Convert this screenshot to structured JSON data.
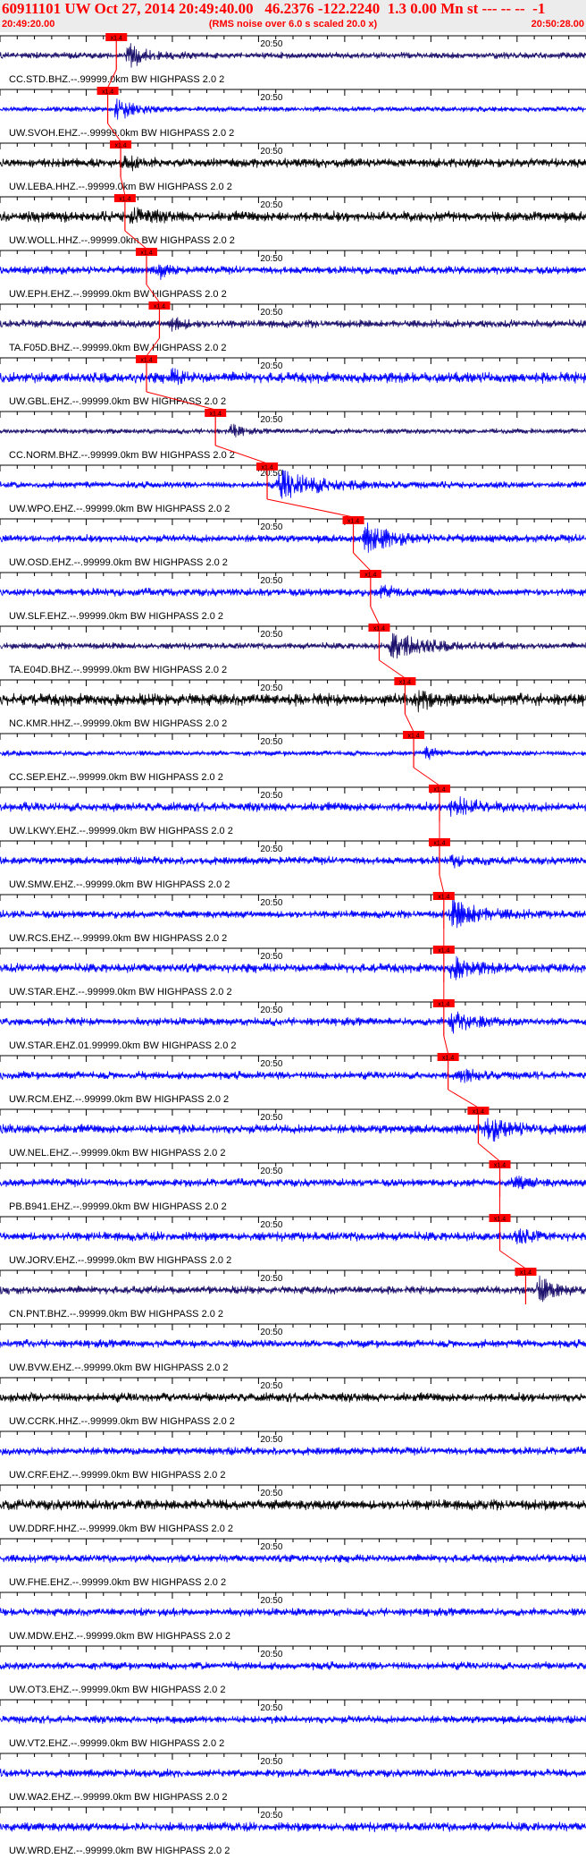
{
  "header": {
    "title": "60911101 UW Oct 27, 2014 20:49:40.00   46.2376 -122.2240  1.3 0.00 Mn st --- -- --  -1",
    "start_time": "20:49:20.00",
    "scale_note": "(RMS noise over 6.0 s scaled 20.0 x)",
    "end_time": "20:50:28.00"
  },
  "time_axis": {
    "minute_label": "20:50",
    "seconds_span": 68
  },
  "colors": {
    "background": "#ffffff",
    "header_bg": "#ececec",
    "header_text": "#ff0000",
    "axis": "#000000",
    "pick": "#ff0000",
    "trace_blue": "#0000ff",
    "trace_navy": "#1a0f6b",
    "trace_black": "#000000"
  },
  "stations": [
    {
      "label": "CC.STD.BHZ.--.99999.0km BW  HIGHPASS  2.0  2",
      "pick": "x1.4",
      "color": "navy",
      "pick_s": 13.5,
      "onset_s": 14.5,
      "duration_s": 4,
      "peak": 1.0,
      "noise": 0.25
    },
    {
      "label": "UW.SVOH.EHZ.--.99999.0km BW  HIGHPASS  2.0  2",
      "pick": "x1.4",
      "color": "blue",
      "pick_s": 12.5,
      "onset_s": 13.0,
      "duration_s": 4,
      "peak": 1.0,
      "noise": 0.2
    },
    {
      "label": "UW.LEBA.HHZ.--.99999.0km BW  HIGHPASS  2.0  2",
      "pick": "x1.4",
      "color": "black",
      "pick_s": 14.0,
      "onset_s": 14.0,
      "duration_s": 3,
      "peak": 0.6,
      "noise": 0.35
    },
    {
      "label": "UW.WOLL.HHZ.--.99999.0km BW  HIGHPASS  2.0  2",
      "pick": "x1.4",
      "color": "black",
      "pick_s": 14.5,
      "onset_s": 15.0,
      "duration_s": 4,
      "peak": 0.6,
      "noise": 0.4
    },
    {
      "label": "UW.EPH.EHZ.--.99999.0km BW  HIGHPASS  2.0  2",
      "pick": "x1.4",
      "color": "blue",
      "pick_s": 17.0,
      "onset_s": 18.0,
      "duration_s": 2,
      "peak": 0.8,
      "noise": 0.3
    },
    {
      "label": "TA.F05D.BHZ.--.99999.0km BW  HIGHPASS  2.0  2",
      "pick": "x1.4",
      "color": "navy",
      "pick_s": 18.5,
      "onset_s": 19.5,
      "duration_s": 3,
      "peak": 0.6,
      "noise": 0.3
    },
    {
      "label": "UW.GBL.EHZ.--.99999.0km BW  HIGHPASS  2.0  2",
      "pick": "x1.4",
      "color": "blue",
      "pick_s": 17.0,
      "onset_s": 19.5,
      "duration_s": 3,
      "peak": 0.5,
      "noise": 0.4
    },
    {
      "label": "CC.NORM.BHZ.--.99999.0km BW  HIGHPASS  2.0  2",
      "pick": "x1.4",
      "color": "navy",
      "pick_s": 25.0,
      "onset_s": 26.5,
      "duration_s": 2,
      "peak": 0.8,
      "noise": 0.2
    },
    {
      "label": "UW.WPO.EHZ.--.99999.0km BW  HIGHPASS  2.0  2",
      "pick": "x1.4",
      "color": "blue",
      "pick_s": 31.0,
      "onset_s": 32.0,
      "duration_s": 10,
      "peak": 1.0,
      "noise": 0.25
    },
    {
      "label": "UW.OSD.EHZ.--.99999.0km BW  HIGHPASS  2.0  2",
      "pick": "x1.4",
      "color": "blue",
      "pick_s": 41.0,
      "onset_s": 42.0,
      "duration_s": 6,
      "peak": 1.0,
      "noise": 0.3
    },
    {
      "label": "UW.SLF.EHZ.--.99999.0km BW  HIGHPASS  2.0  2",
      "pick": "x1.4",
      "color": "blue",
      "pick_s": 43.0,
      "onset_s": 44.0,
      "duration_s": 3,
      "peak": 0.6,
      "noise": 0.3
    },
    {
      "label": "TA.E04D.BHZ.--.99999.0km BW  HIGHPASS  2.0  2",
      "pick": "x1.4",
      "color": "navy",
      "pick_s": 44.0,
      "onset_s": 45.0,
      "duration_s": 8,
      "peak": 1.0,
      "noise": 0.25
    },
    {
      "label": "NC.KMR.HHZ.--.99999.0km BW  HIGHPASS  2.0  2",
      "pick": "x1.4",
      "color": "black",
      "pick_s": 47.0,
      "onset_s": 48.0,
      "duration_s": 3,
      "peak": 0.8,
      "noise": 0.45
    },
    {
      "label": "CC.SEP.EHZ.--.99999.0km BW  HIGHPASS  2.0  2",
      "pick": "x1.4",
      "color": "blue",
      "pick_s": 48.0,
      "onset_s": 49.0,
      "duration_s": 3,
      "peak": 0.5,
      "noise": 0.2
    },
    {
      "label": "UW.LKWY.EHZ.--.99999.0km BW  HIGHPASS  2.0  2",
      "pick": "x1.4",
      "color": "blue",
      "pick_s": 51.0,
      "onset_s": 52.0,
      "duration_s": 5,
      "peak": 0.8,
      "noise": 0.35
    },
    {
      "label": "UW.SMW.EHZ.--.99999.0km BW  HIGHPASS  2.0  2",
      "pick": "x1.4",
      "color": "blue",
      "pick_s": 51.0,
      "onset_s": 52.0,
      "duration_s": 3,
      "peak": 0.4,
      "noise": 0.3
    },
    {
      "label": "UW.RCS.EHZ.--.99999.0km BW  HIGHPASS  2.0  2",
      "pick": "x1.4",
      "color": "blue",
      "pick_s": 51.5,
      "onset_s": 52.0,
      "duration_s": 7,
      "peak": 1.0,
      "noise": 0.3
    },
    {
      "label": "UW.STAR.EHZ.--.99999.0km BW  HIGHPASS  2.0  2",
      "pick": "x1.4",
      "color": "blue",
      "pick_s": 51.5,
      "onset_s": 52.0,
      "duration_s": 5,
      "peak": 0.8,
      "noise": 0.35
    },
    {
      "label": "UW.STAR.EHZ.01.99999.0km BW  HIGHPASS  2.0  2",
      "pick": "x1.4",
      "color": "blue",
      "pick_s": 51.5,
      "onset_s": 52.0,
      "duration_s": 5,
      "peak": 0.8,
      "noise": 0.3
    },
    {
      "label": "UW.RCM.EHZ.--.99999.0km BW  HIGHPASS  2.0  2",
      "pick": "x1.4",
      "color": "blue",
      "pick_s": 52.0,
      "onset_s": 53.0,
      "duration_s": 4,
      "peak": 0.6,
      "noise": 0.3
    },
    {
      "label": "UW.NEL.EHZ.--.99999.0km BW  HIGHPASS  2.0  2",
      "pick": "x1.4",
      "color": "blue",
      "pick_s": 55.5,
      "onset_s": 56.0,
      "duration_s": 6,
      "peak": 0.8,
      "noise": 0.35
    },
    {
      "label": "PB.B941.EHZ.--.99999.0km BW  HIGHPASS  2.0  2",
      "pick": "x1.4",
      "color": "blue",
      "pick_s": 58.0,
      "onset_s": 59.0,
      "duration_s": 4,
      "peak": 0.5,
      "noise": 0.3
    },
    {
      "label": "UW.JORV.EHZ.--.99999.0km BW  HIGHPASS  2.0  2",
      "pick": "x1.4",
      "color": "blue",
      "pick_s": 58.0,
      "onset_s": 59.5,
      "duration_s": 3,
      "peak": 0.6,
      "noise": 0.35
    },
    {
      "label": "CN.PNT.BHZ.--.99999.0km BW  HIGHPASS  2.0  2",
      "pick": "x1.4",
      "color": "navy",
      "pick_s": 61.0,
      "onset_s": 62.0,
      "duration_s": 4,
      "peak": 1.0,
      "noise": 0.3
    },
    {
      "label": "UW.BVW.EHZ.--.99999.0km BW  HIGHPASS  2.0  2",
      "pick": "",
      "color": "blue",
      "onset_s": 0,
      "duration_s": 0,
      "peak": 0,
      "noise": 0.3
    },
    {
      "label": "UW.CCRK.HHZ.--.99999.0km BW  HIGHPASS  2.0  2",
      "pick": "",
      "color": "black",
      "onset_s": 0,
      "duration_s": 0,
      "peak": 0,
      "noise": 0.35
    },
    {
      "label": "UW.CRF.EHZ.--.99999.0km BW  HIGHPASS  2.0  2",
      "pick": "",
      "color": "blue",
      "onset_s": 0,
      "duration_s": 0,
      "peak": 0,
      "noise": 0.3
    },
    {
      "label": "UW.DDRF.HHZ.--.99999.0km BW  HIGHPASS  2.0  2",
      "pick": "",
      "color": "black",
      "onset_s": 0,
      "duration_s": 0,
      "peak": 0,
      "noise": 0.4
    },
    {
      "label": "UW.FHE.EHZ.--.99999.0km BW  HIGHPASS  2.0  2",
      "pick": "",
      "color": "blue",
      "onset_s": 0,
      "duration_s": 0,
      "peak": 0,
      "noise": 0.3
    },
    {
      "label": "UW.MDW.EHZ.--.99999.0km BW  HIGHPASS  2.0  2",
      "pick": "",
      "color": "blue",
      "onset_s": 0,
      "duration_s": 0,
      "peak": 0,
      "noise": 0.3
    },
    {
      "label": "UW.OT3.EHZ.--.99999.0km BW  HIGHPASS  2.0  2",
      "pick": "",
      "color": "blue",
      "onset_s": 0,
      "duration_s": 0,
      "peak": 0,
      "noise": 0.3
    },
    {
      "label": "UW.VT2.EHZ.--.99999.0km BW  HIGHPASS  2.0  2",
      "pick": "",
      "color": "blue",
      "onset_s": 0,
      "duration_s": 0,
      "peak": 0,
      "noise": 0.3
    },
    {
      "label": "UW.WA2.EHZ.--.99999.0km BW  HIGHPASS  2.0  2",
      "pick": "",
      "color": "blue",
      "onset_s": 0,
      "duration_s": 0,
      "peak": 0,
      "noise": 0.3
    },
    {
      "label": "UW.WRD.EHZ.--.99999.0km BW  HIGHPASS  2.0  2",
      "pick": "",
      "color": "blue",
      "onset_s": 0,
      "duration_s": 0,
      "peak": 0,
      "noise": 0.35
    }
  ]
}
